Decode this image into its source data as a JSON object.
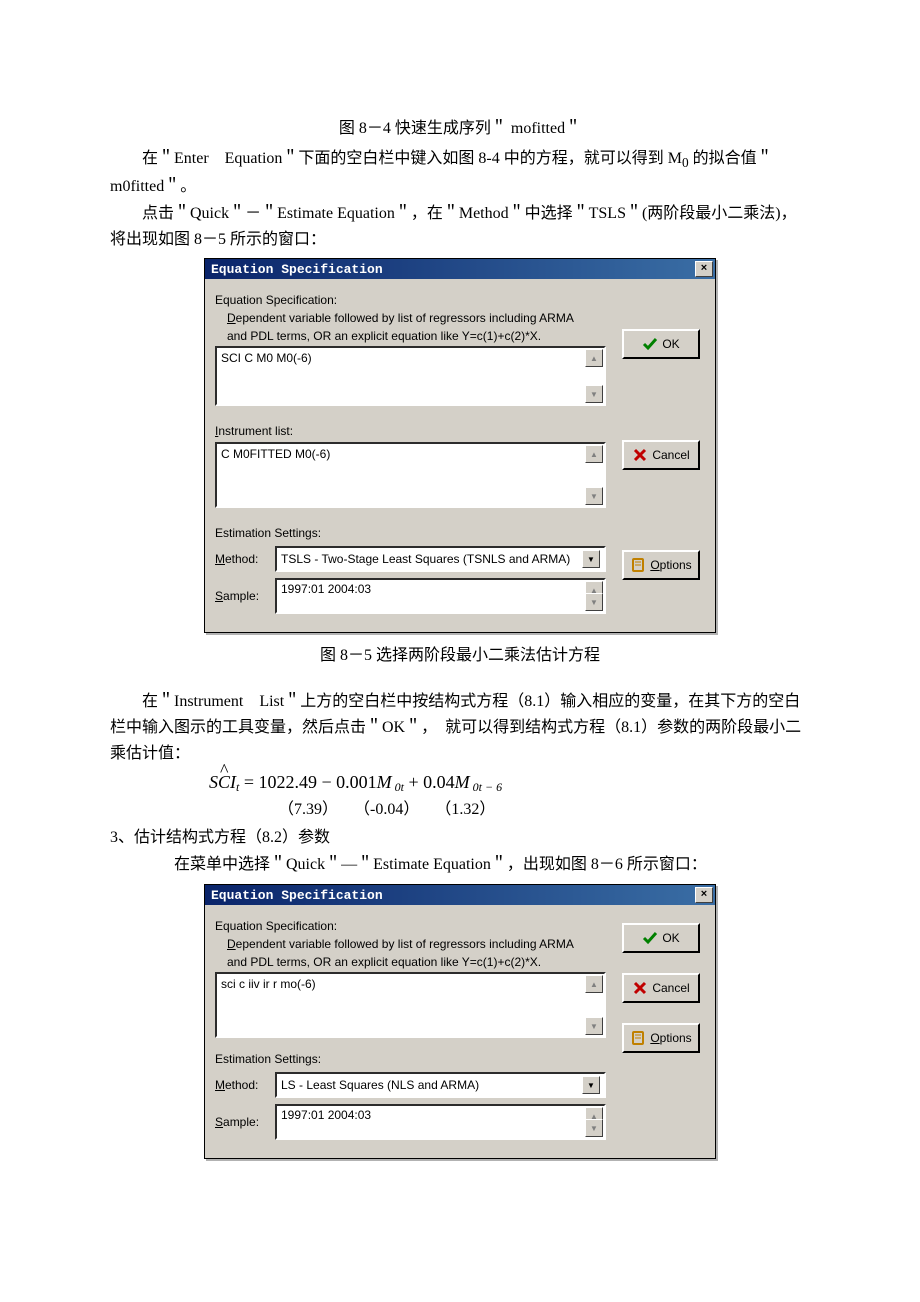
{
  "captions": {
    "fig84": "图 8－4  快速生成序列＂ mofitted＂",
    "fig85": "图 8－5  选择两阶段最小二乘法估计方程"
  },
  "paragraphs": {
    "p1a": "在＂Enter　Equation＂下面的空白栏中键入如图 8-4 中的方程，就可以得到 M",
    "p1sub": "0",
    "p1b": " 的拟合值＂m0fitted＂。",
    "p2": "点击＂Quick＂－＂Estimate Equation＂，在＂Method＂中选择＂TSLS＂(两阶段最小二乘法)，将出现如图 8－5 所示的窗口：",
    "p3": "在＂Instrument　List＂上方的空白栏中按结构式方程（8.1）输入相应的变量，在其下方的空白栏中输入图示的工具变量，然后点击＂OK＂，　就可以得到结构式方程（8.1）参数的两阶段最小二乘估计值：",
    "formula": "SĈIₜ = 1022.49 − 0.001M₀ₜ + 0.04M₀ₜ₋₆",
    "tstats": "（7.39）　　（-0.04）　　（1.32）",
    "p4": "3、估计结构式方程（8.2）参数",
    "p5": "在菜单中选择＂Quick＂—＂Estimate Equation＂，出现如图 8－6 所示窗口："
  },
  "dlg1": {
    "title": "Equation Specification",
    "sec1": "Equation Specification:",
    "hint_a_pre": "D",
    "hint_a": "ependent variable followed by list of regressors including ARMA",
    "hint_b": "and PDL terms, OR an explicit equation like Y=c(1)+c(2)*X.",
    "eq_text": "SCI C M0 M0(-6)",
    "instr_label_pre": "I",
    "instr_label": "nstrument list:",
    "instr_text": "C M0FITTED M0(-6)",
    "est_label": "Estimation Settings:",
    "method_label_pre": "M",
    "method_label": "ethod:",
    "method_value": "TSLS - Two-Stage Least Squares (TSNLS and ARMA)",
    "sample_label_pre": "S",
    "sample_label": "ample:",
    "sample_value": "1997:01 2004:03",
    "ok": "OK",
    "cancel": "Cancel",
    "options_pre": "O",
    "options": "ptions"
  },
  "dlg2": {
    "title": "Equation Specification",
    "sec1": "Equation Specification:",
    "hint_a_pre": "D",
    "hint_a": "ependent variable followed by list of regressors including ARMA",
    "hint_b": "and PDL terms, OR an explicit equation like Y=c(1)+c(2)*X.",
    "eq_text": "sci c iiv ir r mo(-6)",
    "est_label": "Estimation Settings:",
    "method_label_pre": "M",
    "method_label": "ethod:",
    "method_value": "LS - Least Squares (NLS and ARMA)",
    "sample_label_pre": "S",
    "sample_label": "ample:",
    "sample_value": "1997:01 2004:03",
    "ok": "OK",
    "cancel": "Cancel",
    "options_pre": "O",
    "options": "ptions"
  }
}
